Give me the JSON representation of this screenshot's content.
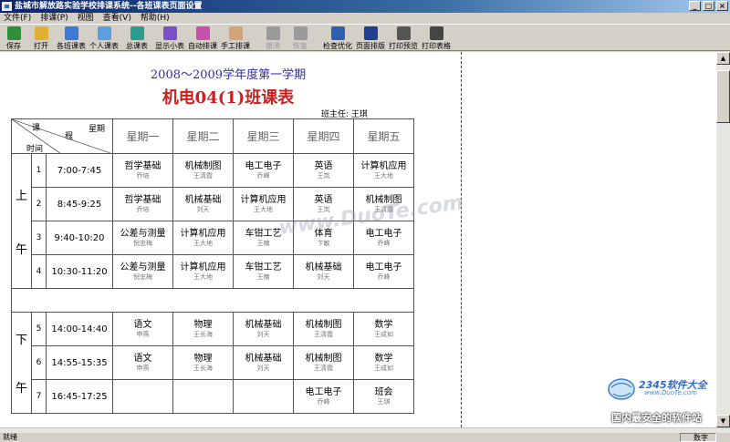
{
  "window": {
    "title": "盐城市解放路实验学校排课系统--各班课表页面设置"
  },
  "menu": [
    "文件(F)",
    "排课(P)",
    "视图",
    "查看(V)",
    "帮助(H)"
  ],
  "toolbar": [
    {
      "label": "保存",
      "icon": "save-icon",
      "color": "#2f8f3a"
    },
    {
      "label": "打开",
      "icon": "open-folder-icon",
      "color": "#e0b030"
    },
    {
      "label": "各班课表",
      "icon": "class-schedule-icon",
      "color": "#3b7bd6"
    },
    {
      "label": "个人课表",
      "icon": "personal-schedule-icon",
      "color": "#5aa0e0"
    },
    {
      "label": "总课表",
      "icon": "master-schedule-icon",
      "color": "#2a9d8f"
    },
    {
      "label": "显示小表",
      "icon": "mini-table-icon",
      "color": "#7b4fc9"
    },
    {
      "label": "自动排课",
      "icon": "auto-schedule-icon",
      "color": "#c74fb0"
    },
    {
      "label": "手工排课",
      "icon": "hand-icon",
      "color": "#d4a373"
    },
    {
      "label": "撤消",
      "icon": "undo-icon",
      "color": "#9a9a9a",
      "disabled": true
    },
    {
      "label": "恢复",
      "icon": "redo-icon",
      "color": "#9a9a9a",
      "disabled": true
    },
    {
      "label": "检查优化",
      "icon": "magnifier-icon",
      "color": "#2f5fb0"
    },
    {
      "label": "页面排版",
      "icon": "page-layout-icon",
      "color": "#1f3f8f"
    },
    {
      "label": "打印预览",
      "icon": "print-preview-icon",
      "color": "#555555"
    },
    {
      "label": "打印表格",
      "icon": "printer-icon",
      "color": "#444444"
    }
  ],
  "page": {
    "term": "2008～2009学年度第一学期",
    "class_title": "机电04(1)班课表",
    "head_teacher": "班主任: 王琪"
  },
  "table": {
    "corner": {
      "weekday": "星期",
      "period": "程",
      "course": "课",
      "time": "时间"
    },
    "days": [
      "星期一",
      "星期二",
      "星期三",
      "星期四",
      "星期五"
    ],
    "morning_label": [
      "上",
      "午"
    ],
    "afternoon_label": [
      "下",
      "午"
    ],
    "morning": [
      {
        "num": "1",
        "time": "7:00-7:45",
        "cells": [
          [
            "哲学基础",
            "乔培"
          ],
          [
            "机械制图",
            "王清霞"
          ],
          [
            "电工电子",
            "乔峰"
          ],
          [
            "英语",
            "王岚"
          ],
          [
            "计算机应用",
            "王大地"
          ]
        ]
      },
      {
        "num": "2",
        "time": "8:45-9:25",
        "cells": [
          [
            "哲学基础",
            "乔培"
          ],
          [
            "机械基础",
            "刘天"
          ],
          [
            "计算机应用",
            "王大地"
          ],
          [
            "英语",
            "王岚"
          ],
          [
            "机械制图",
            "王清霞"
          ]
        ]
      },
      {
        "num": "3",
        "time": "9:40-10:20",
        "cells": [
          [
            "公差与测量",
            "倪忠梅"
          ],
          [
            "计算机应用",
            "王大地"
          ],
          [
            "车钳工艺",
            "王楠"
          ],
          [
            "体育",
            "卞敏"
          ],
          [
            "电工电子",
            "乔峰"
          ]
        ]
      },
      {
        "num": "4",
        "time": "10:30-11:20",
        "cells": [
          [
            "公差与测量",
            "倪忠梅"
          ],
          [
            "计算机应用",
            "王大地"
          ],
          [
            "车钳工艺",
            "王楠"
          ],
          [
            "机械基础",
            "刘天"
          ],
          [
            "电工电子",
            "乔峰"
          ]
        ]
      }
    ],
    "afternoon": [
      {
        "num": "5",
        "time": "14:00-14:40",
        "cells": [
          [
            "语文",
            "申燕"
          ],
          [
            "物理",
            "王长海"
          ],
          [
            "机械基础",
            "刘天"
          ],
          [
            "机械制图",
            "王清霞"
          ],
          [
            "数学",
            "王成如"
          ]
        ]
      },
      {
        "num": "6",
        "time": "14:55-15:35",
        "cells": [
          [
            "语文",
            "申燕"
          ],
          [
            "物理",
            "王长海"
          ],
          [
            "机械基础",
            "刘天"
          ],
          [
            "机械制图",
            "王清霞"
          ],
          [
            "数学",
            "王成如"
          ]
        ]
      },
      {
        "num": "7",
        "time": "16:45-17:25",
        "cells": [
          [
            "",
            ""
          ],
          [
            "",
            ""
          ],
          [
            "",
            ""
          ],
          [
            "电工电子",
            "乔峰"
          ],
          [
            "班会",
            "王琪"
          ]
        ]
      }
    ]
  },
  "watermark": "www.DuoTe.com",
  "corner_logo": {
    "brand": "2345软件大全",
    "url": "www.DuoTe.com",
    "slogan": "国内最安全的软件站"
  },
  "status": {
    "left": "就绪",
    "right": "数字"
  }
}
